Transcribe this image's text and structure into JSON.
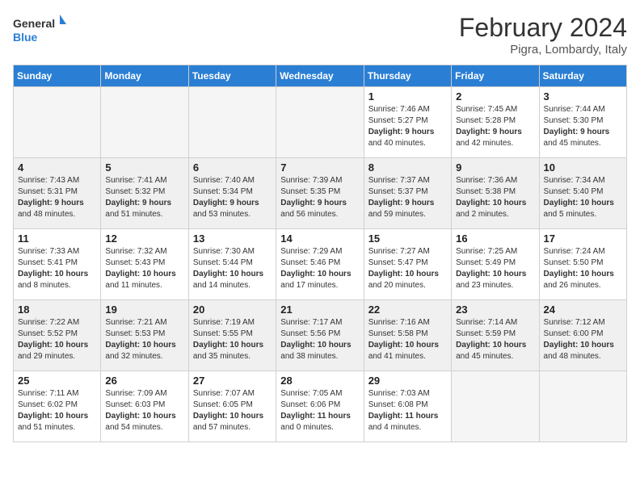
{
  "header": {
    "logo_line1": "General",
    "logo_line2": "Blue",
    "month_year": "February 2024",
    "location": "Pigra, Lombardy, Italy"
  },
  "weekdays": [
    "Sunday",
    "Monday",
    "Tuesday",
    "Wednesday",
    "Thursday",
    "Friday",
    "Saturday"
  ],
  "weeks": [
    {
      "shaded": false,
      "days": [
        {
          "num": "",
          "info": ""
        },
        {
          "num": "",
          "info": ""
        },
        {
          "num": "",
          "info": ""
        },
        {
          "num": "",
          "info": ""
        },
        {
          "num": "1",
          "info": "Sunrise: 7:46 AM\nSunset: 5:27 PM\nDaylight: 9 hours\nand 40 minutes."
        },
        {
          "num": "2",
          "info": "Sunrise: 7:45 AM\nSunset: 5:28 PM\nDaylight: 9 hours\nand 42 minutes."
        },
        {
          "num": "3",
          "info": "Sunrise: 7:44 AM\nSunset: 5:30 PM\nDaylight: 9 hours\nand 45 minutes."
        }
      ]
    },
    {
      "shaded": true,
      "days": [
        {
          "num": "4",
          "info": "Sunrise: 7:43 AM\nSunset: 5:31 PM\nDaylight: 9 hours\nand 48 minutes."
        },
        {
          "num": "5",
          "info": "Sunrise: 7:41 AM\nSunset: 5:32 PM\nDaylight: 9 hours\nand 51 minutes."
        },
        {
          "num": "6",
          "info": "Sunrise: 7:40 AM\nSunset: 5:34 PM\nDaylight: 9 hours\nand 53 minutes."
        },
        {
          "num": "7",
          "info": "Sunrise: 7:39 AM\nSunset: 5:35 PM\nDaylight: 9 hours\nand 56 minutes."
        },
        {
          "num": "8",
          "info": "Sunrise: 7:37 AM\nSunset: 5:37 PM\nDaylight: 9 hours\nand 59 minutes."
        },
        {
          "num": "9",
          "info": "Sunrise: 7:36 AM\nSunset: 5:38 PM\nDaylight: 10 hours\nand 2 minutes."
        },
        {
          "num": "10",
          "info": "Sunrise: 7:34 AM\nSunset: 5:40 PM\nDaylight: 10 hours\nand 5 minutes."
        }
      ]
    },
    {
      "shaded": false,
      "days": [
        {
          "num": "11",
          "info": "Sunrise: 7:33 AM\nSunset: 5:41 PM\nDaylight: 10 hours\nand 8 minutes."
        },
        {
          "num": "12",
          "info": "Sunrise: 7:32 AM\nSunset: 5:43 PM\nDaylight: 10 hours\nand 11 minutes."
        },
        {
          "num": "13",
          "info": "Sunrise: 7:30 AM\nSunset: 5:44 PM\nDaylight: 10 hours\nand 14 minutes."
        },
        {
          "num": "14",
          "info": "Sunrise: 7:29 AM\nSunset: 5:46 PM\nDaylight: 10 hours\nand 17 minutes."
        },
        {
          "num": "15",
          "info": "Sunrise: 7:27 AM\nSunset: 5:47 PM\nDaylight: 10 hours\nand 20 minutes."
        },
        {
          "num": "16",
          "info": "Sunrise: 7:25 AM\nSunset: 5:49 PM\nDaylight: 10 hours\nand 23 minutes."
        },
        {
          "num": "17",
          "info": "Sunrise: 7:24 AM\nSunset: 5:50 PM\nDaylight: 10 hours\nand 26 minutes."
        }
      ]
    },
    {
      "shaded": true,
      "days": [
        {
          "num": "18",
          "info": "Sunrise: 7:22 AM\nSunset: 5:52 PM\nDaylight: 10 hours\nand 29 minutes."
        },
        {
          "num": "19",
          "info": "Sunrise: 7:21 AM\nSunset: 5:53 PM\nDaylight: 10 hours\nand 32 minutes."
        },
        {
          "num": "20",
          "info": "Sunrise: 7:19 AM\nSunset: 5:55 PM\nDaylight: 10 hours\nand 35 minutes."
        },
        {
          "num": "21",
          "info": "Sunrise: 7:17 AM\nSunset: 5:56 PM\nDaylight: 10 hours\nand 38 minutes."
        },
        {
          "num": "22",
          "info": "Sunrise: 7:16 AM\nSunset: 5:58 PM\nDaylight: 10 hours\nand 41 minutes."
        },
        {
          "num": "23",
          "info": "Sunrise: 7:14 AM\nSunset: 5:59 PM\nDaylight: 10 hours\nand 45 minutes."
        },
        {
          "num": "24",
          "info": "Sunrise: 7:12 AM\nSunset: 6:00 PM\nDaylight: 10 hours\nand 48 minutes."
        }
      ]
    },
    {
      "shaded": false,
      "days": [
        {
          "num": "25",
          "info": "Sunrise: 7:11 AM\nSunset: 6:02 PM\nDaylight: 10 hours\nand 51 minutes."
        },
        {
          "num": "26",
          "info": "Sunrise: 7:09 AM\nSunset: 6:03 PM\nDaylight: 10 hours\nand 54 minutes."
        },
        {
          "num": "27",
          "info": "Sunrise: 7:07 AM\nSunset: 6:05 PM\nDaylight: 10 hours\nand 57 minutes."
        },
        {
          "num": "28",
          "info": "Sunrise: 7:05 AM\nSunset: 6:06 PM\nDaylight: 11 hours\nand 0 minutes."
        },
        {
          "num": "29",
          "info": "Sunrise: 7:03 AM\nSunset: 6:08 PM\nDaylight: 11 hours\nand 4 minutes."
        },
        {
          "num": "",
          "info": ""
        },
        {
          "num": "",
          "info": ""
        }
      ]
    }
  ]
}
